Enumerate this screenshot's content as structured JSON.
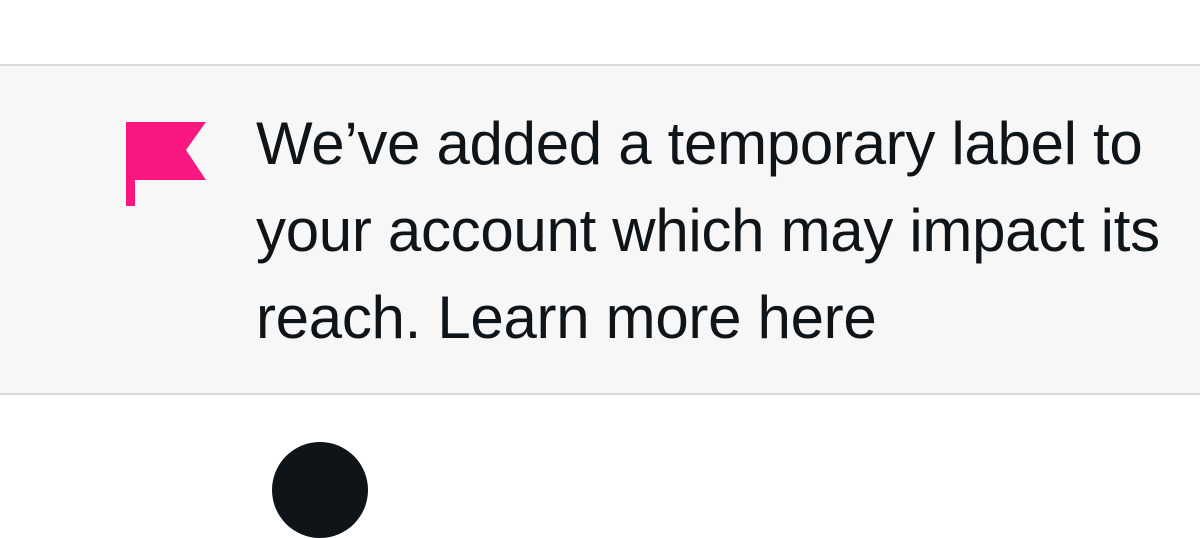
{
  "notice": {
    "icon": "flag-icon",
    "accent_color": "#f91880",
    "text_line_1": "We’ve added a temporary label to",
    "text_line_2": "your account which may impact its",
    "text_line_3_prefix": "reach.",
    "link_label": "Learn more here"
  },
  "colors": {
    "text": "#0f1419",
    "notice_background": "#f7f7f7",
    "divider": "#d9dcdf"
  }
}
